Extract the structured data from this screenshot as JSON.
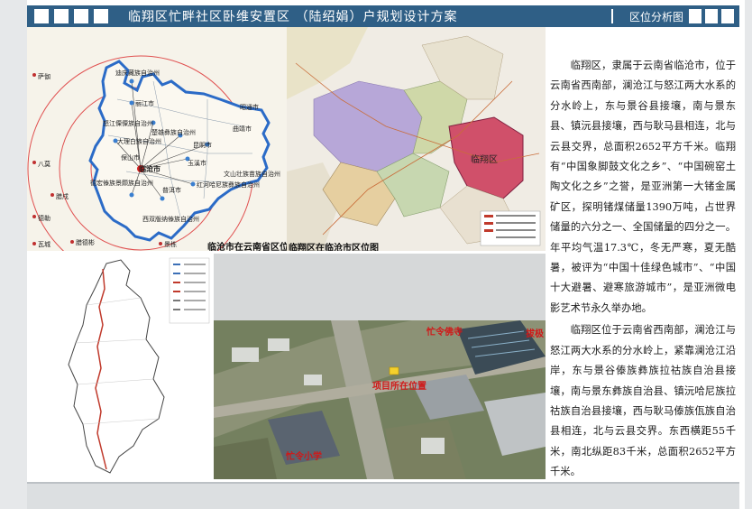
{
  "header": {
    "title": "临翔区忙畔社区卧维安置区 （陆绍娟）户规划设计方案",
    "section": "区位分析图",
    "color": "#2f5f86"
  },
  "maps": {
    "yunnan_caption": "临沧市在云南省区位图",
    "yunnan_city": "临沧市",
    "yunnan_places": [
      "迪庆藏族自治州",
      "丽江市",
      "怒江傈僳族自治州",
      "大理白族自治州",
      "保山市",
      "德宏傣族景颇族自治州",
      "昆明市",
      "玉溪市",
      "普洱市",
      "西双版纳傣族自治州",
      "红河哈尼族彝族自治州",
      "文山壮族苗族自治州",
      "曲靖市",
      "昭通市",
      "楚雄彝族自治州"
    ],
    "neighbor_countries": [
      "萨伽",
      "八莫",
      "腊戌",
      "德勒",
      "瓦城",
      "腊德彬",
      "景栋"
    ],
    "lincang_caption": "临翔区在临沧市区位图",
    "lincang_district": "临翔区"
  },
  "aerial": {
    "labels": {
      "site": "项目所在位置",
      "school": "忙令小学",
      "shop": "忙令佛寺",
      "road": "拔极"
    }
  },
  "text": {
    "paragraph1": "临翔区，隶属于云南省临沧市，位于云南省西南部，澜沧江与怒江两大水系的分水岭上，东与景谷县接壤，南与景东县、镇沅县接壤，西与耿马县相连，北与云县交界，总面积2652平方千米。临翔有“中国象脚鼓文化之乡”、“中国碗窑土陶文化之乡”之誉，是亚洲第一大锗金属矿区，探明锗煤储量1390万吨，占世界储量的六分之一、全国储量的四分之一。年平均气温17.3℃，冬无严寒，夏无酷暑，被评为“中国十佳绿色城市”、“中国十大避暑、避寒旅游城市”，是亚洲微电影艺术节永久举办地。",
    "paragraph2": "临翔区位于云南省西南部，澜沧江与怒江两大水系的分水岭上，紧靠澜沧江沿岸，东与景谷傣族彝族拉祜族自治县接壤，南与景东彝族自治县、镇沅哈尼族拉祜族自治县接壤，西与耿马傣族佤族自治县相连，北与云县交界。东西横距55千米，南北纵距83千米，总面积2652平方千米。"
  }
}
